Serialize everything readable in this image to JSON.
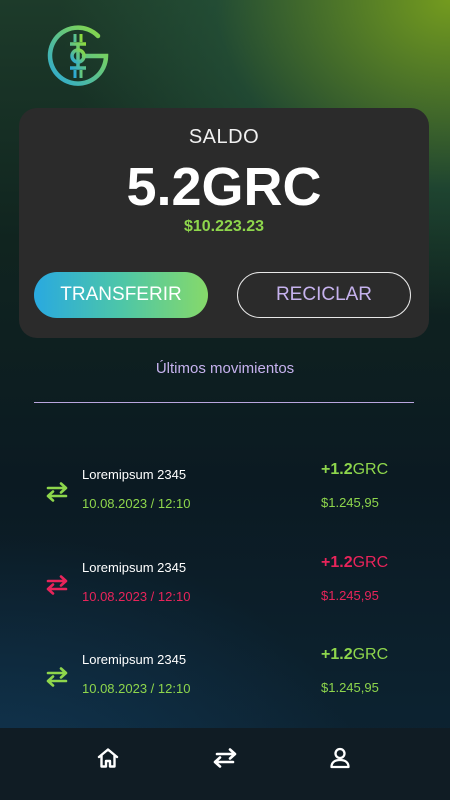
{
  "colors": {
    "accent_green": "#8ed64c",
    "negative_red": "#e8245a",
    "lilac": "#c6b2ee",
    "card_bg": "#2b2b2b"
  },
  "logo": {
    "icon": "graincoin-logo-icon"
  },
  "balance": {
    "label": "SALDO",
    "amount": "5.2GRC",
    "fiat": "$10.223.23"
  },
  "actions": {
    "transfer_label": "TRANSFERIR",
    "recycle_label": "RECICLAR"
  },
  "movements": {
    "title": "Últimos movimientos",
    "items": [
      {
        "name": "Loremipsum 2345",
        "date": "10.08.2023 / 12:10",
        "amount_value": "+1.2",
        "amount_unit": "GRC",
        "fiat": "$1.245,95",
        "status": "positive",
        "icon": "transfer-arrows-icon"
      },
      {
        "name": "Loremipsum 2345",
        "date": "10.08.2023 / 12:10",
        "amount_value": "+1.2",
        "amount_unit": "GRC",
        "fiat": "$1.245,95",
        "status": "negative",
        "icon": "transfer-arrows-icon"
      },
      {
        "name": "Loremipsum 2345",
        "date": "10.08.2023 / 12:10",
        "amount_value": "+1.2",
        "amount_unit": "GRC",
        "fiat": "$1.245,95",
        "status": "positive",
        "icon": "transfer-arrows-icon"
      }
    ]
  },
  "nav": {
    "items": [
      {
        "icon": "home-icon"
      },
      {
        "icon": "transfer-arrows-icon"
      },
      {
        "icon": "user-icon"
      }
    ]
  }
}
